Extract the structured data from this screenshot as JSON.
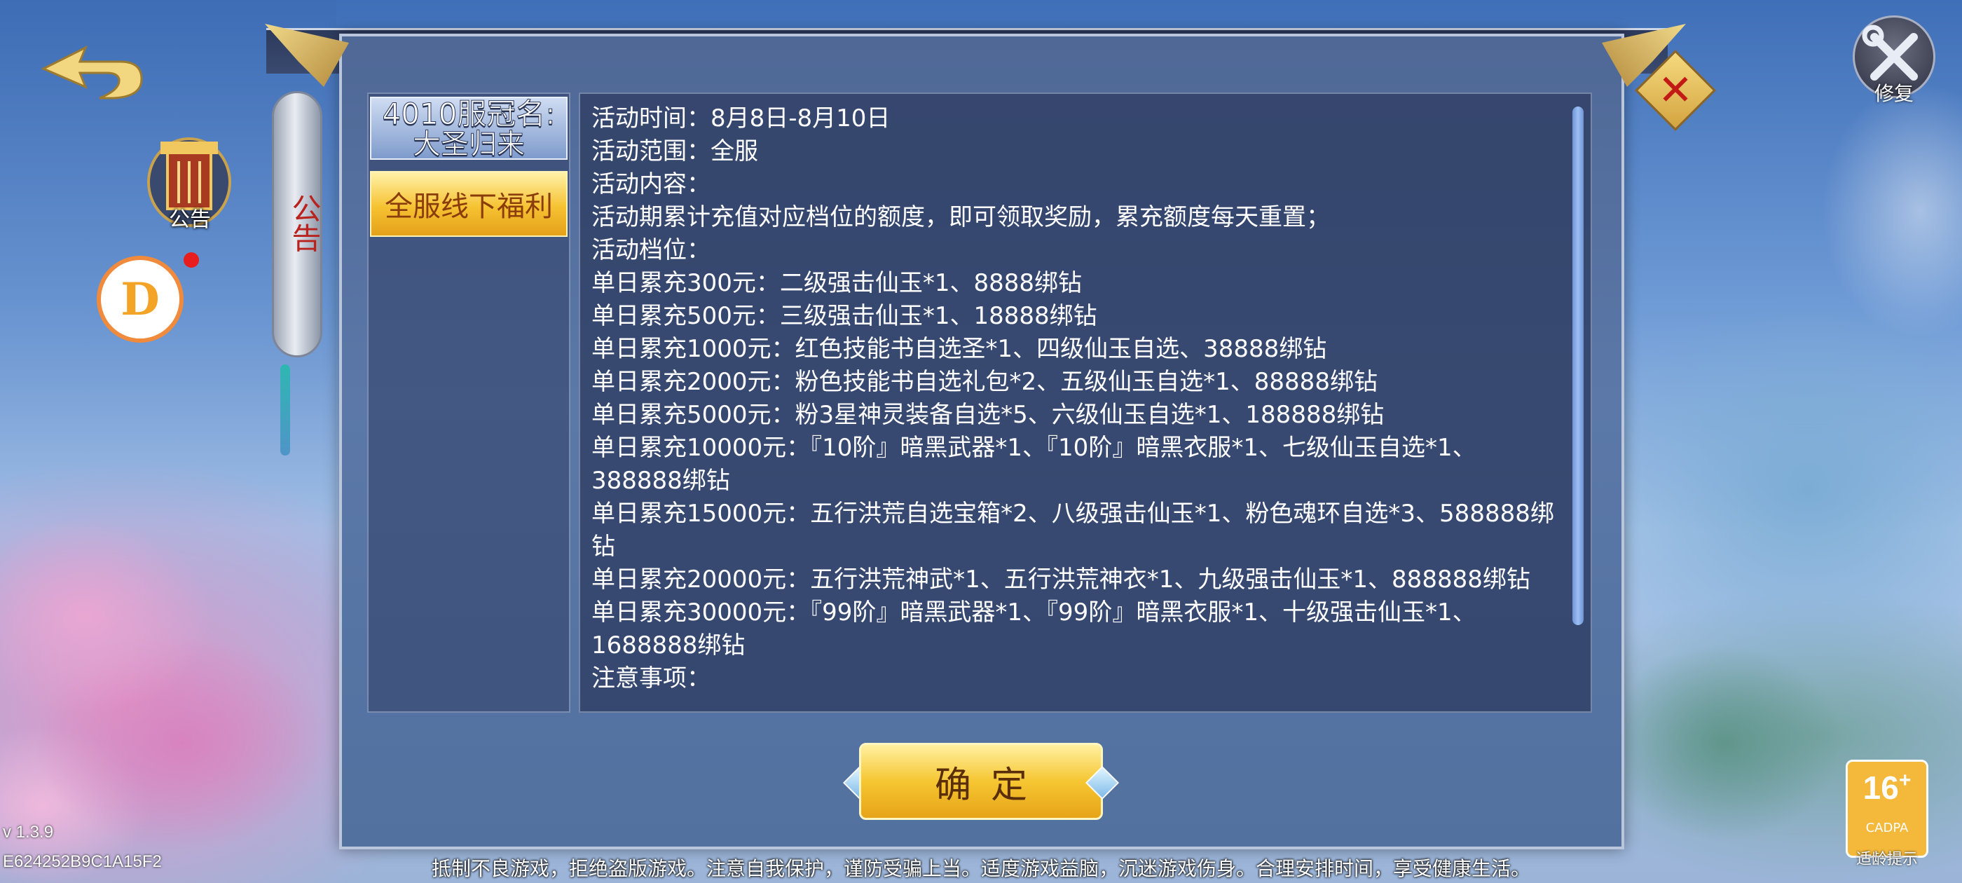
{
  "background": {
    "accent": "#f6c232"
  },
  "back_button": {
    "icon": "back-arrow-icon"
  },
  "side_icons": {
    "notice_label": "公告",
    "d_letter": "D"
  },
  "repair": {
    "label": "修复",
    "icon": "repair-tools-icon"
  },
  "dialog": {
    "banner": "公告",
    "close_icon": "close-icon",
    "tabs": [
      {
        "line1": "4010服冠名:",
        "line2": "大圣归来"
      },
      {
        "label": "全服线下福利"
      }
    ],
    "content": [
      "活动时间：8月8日-8月10日",
      "活动范围：全服",
      "活动内容：",
      "活动期累计充值对应档位的额度，即可领取奖励，累充额度每天重置；",
      "活动档位：",
      "单日累充300元：二级强击仙玉*1、8888绑钻",
      "单日累充500元：三级强击仙玉*1、18888绑钻",
      "单日累充1000元：红色技能书自选圣*1、四级仙玉自选、38888绑钻",
      "单日累充2000元：粉色技能书自选礼包*2、五级仙玉自选*1、88888绑钻",
      "单日累充5000元：粉3星神灵装备自选*5、六级仙玉自选*1、188888绑钻",
      "单日累充10000元：『10阶』暗黑武器*1、『10阶』暗黑衣服*1、七级仙玉自选*1、388888绑钻",
      "单日累充15000元：五行洪荒自选宝箱*2、八级强击仙玉*1、粉色魂环自选*3、588888绑钻",
      "单日累充20000元：五行洪荒神武*1、五行洪荒神衣*1、九级强击仙玉*1、888888绑钻",
      "单日累充30000元：『99阶』暗黑武器*1、『99阶』暗黑衣服*1、十级强击仙玉*1、1688888绑钻",
      "注意事项："
    ],
    "confirm_label": "确定"
  },
  "footer": {
    "version": "v 1.3.9",
    "device_id": "E624252B9C1A15F2",
    "health_tip": "抵制不良游戏，拒绝盗版游戏。注意自我保护，谨防受骗上当。适度游戏益脑，沉迷游戏伤身。合理安排时间，享受健康生活。"
  },
  "age_rating": {
    "age": "16",
    "plus": "+",
    "org": "CADPA",
    "tip": "适龄提示"
  }
}
